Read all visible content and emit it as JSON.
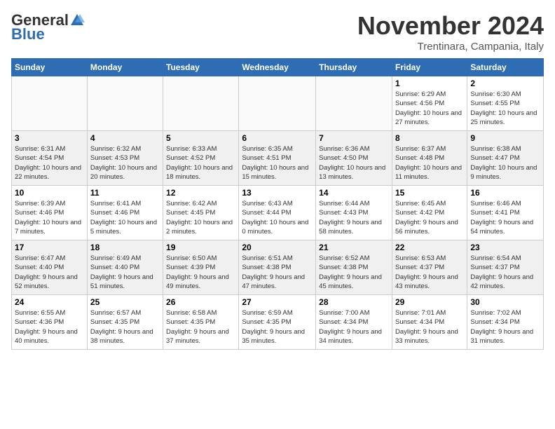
{
  "header": {
    "logo_general": "General",
    "logo_blue": "Blue",
    "title": "November 2024",
    "subtitle": "Trentinara, Campania, Italy"
  },
  "weekdays": [
    "Sunday",
    "Monday",
    "Tuesday",
    "Wednesday",
    "Thursday",
    "Friday",
    "Saturday"
  ],
  "weeks": [
    [
      {
        "day": "",
        "info": ""
      },
      {
        "day": "",
        "info": ""
      },
      {
        "day": "",
        "info": ""
      },
      {
        "day": "",
        "info": ""
      },
      {
        "day": "",
        "info": ""
      },
      {
        "day": "1",
        "info": "Sunrise: 6:29 AM\nSunset: 4:56 PM\nDaylight: 10 hours and 27 minutes."
      },
      {
        "day": "2",
        "info": "Sunrise: 6:30 AM\nSunset: 4:55 PM\nDaylight: 10 hours and 25 minutes."
      }
    ],
    [
      {
        "day": "3",
        "info": "Sunrise: 6:31 AM\nSunset: 4:54 PM\nDaylight: 10 hours and 22 minutes."
      },
      {
        "day": "4",
        "info": "Sunrise: 6:32 AM\nSunset: 4:53 PM\nDaylight: 10 hours and 20 minutes."
      },
      {
        "day": "5",
        "info": "Sunrise: 6:33 AM\nSunset: 4:52 PM\nDaylight: 10 hours and 18 minutes."
      },
      {
        "day": "6",
        "info": "Sunrise: 6:35 AM\nSunset: 4:51 PM\nDaylight: 10 hours and 15 minutes."
      },
      {
        "day": "7",
        "info": "Sunrise: 6:36 AM\nSunset: 4:50 PM\nDaylight: 10 hours and 13 minutes."
      },
      {
        "day": "8",
        "info": "Sunrise: 6:37 AM\nSunset: 4:48 PM\nDaylight: 10 hours and 11 minutes."
      },
      {
        "day": "9",
        "info": "Sunrise: 6:38 AM\nSunset: 4:47 PM\nDaylight: 10 hours and 9 minutes."
      }
    ],
    [
      {
        "day": "10",
        "info": "Sunrise: 6:39 AM\nSunset: 4:46 PM\nDaylight: 10 hours and 7 minutes."
      },
      {
        "day": "11",
        "info": "Sunrise: 6:41 AM\nSunset: 4:46 PM\nDaylight: 10 hours and 5 minutes."
      },
      {
        "day": "12",
        "info": "Sunrise: 6:42 AM\nSunset: 4:45 PM\nDaylight: 10 hours and 2 minutes."
      },
      {
        "day": "13",
        "info": "Sunrise: 6:43 AM\nSunset: 4:44 PM\nDaylight: 10 hours and 0 minutes."
      },
      {
        "day": "14",
        "info": "Sunrise: 6:44 AM\nSunset: 4:43 PM\nDaylight: 9 hours and 58 minutes."
      },
      {
        "day": "15",
        "info": "Sunrise: 6:45 AM\nSunset: 4:42 PM\nDaylight: 9 hours and 56 minutes."
      },
      {
        "day": "16",
        "info": "Sunrise: 6:46 AM\nSunset: 4:41 PM\nDaylight: 9 hours and 54 minutes."
      }
    ],
    [
      {
        "day": "17",
        "info": "Sunrise: 6:47 AM\nSunset: 4:40 PM\nDaylight: 9 hours and 52 minutes."
      },
      {
        "day": "18",
        "info": "Sunrise: 6:49 AM\nSunset: 4:40 PM\nDaylight: 9 hours and 51 minutes."
      },
      {
        "day": "19",
        "info": "Sunrise: 6:50 AM\nSunset: 4:39 PM\nDaylight: 9 hours and 49 minutes."
      },
      {
        "day": "20",
        "info": "Sunrise: 6:51 AM\nSunset: 4:38 PM\nDaylight: 9 hours and 47 minutes."
      },
      {
        "day": "21",
        "info": "Sunrise: 6:52 AM\nSunset: 4:38 PM\nDaylight: 9 hours and 45 minutes."
      },
      {
        "day": "22",
        "info": "Sunrise: 6:53 AM\nSunset: 4:37 PM\nDaylight: 9 hours and 43 minutes."
      },
      {
        "day": "23",
        "info": "Sunrise: 6:54 AM\nSunset: 4:37 PM\nDaylight: 9 hours and 42 minutes."
      }
    ],
    [
      {
        "day": "24",
        "info": "Sunrise: 6:55 AM\nSunset: 4:36 PM\nDaylight: 9 hours and 40 minutes."
      },
      {
        "day": "25",
        "info": "Sunrise: 6:57 AM\nSunset: 4:35 PM\nDaylight: 9 hours and 38 minutes."
      },
      {
        "day": "26",
        "info": "Sunrise: 6:58 AM\nSunset: 4:35 PM\nDaylight: 9 hours and 37 minutes."
      },
      {
        "day": "27",
        "info": "Sunrise: 6:59 AM\nSunset: 4:35 PM\nDaylight: 9 hours and 35 minutes."
      },
      {
        "day": "28",
        "info": "Sunrise: 7:00 AM\nSunset: 4:34 PM\nDaylight: 9 hours and 34 minutes."
      },
      {
        "day": "29",
        "info": "Sunrise: 7:01 AM\nSunset: 4:34 PM\nDaylight: 9 hours and 33 minutes."
      },
      {
        "day": "30",
        "info": "Sunrise: 7:02 AM\nSunset: 4:34 PM\nDaylight: 9 hours and 31 minutes."
      }
    ]
  ]
}
